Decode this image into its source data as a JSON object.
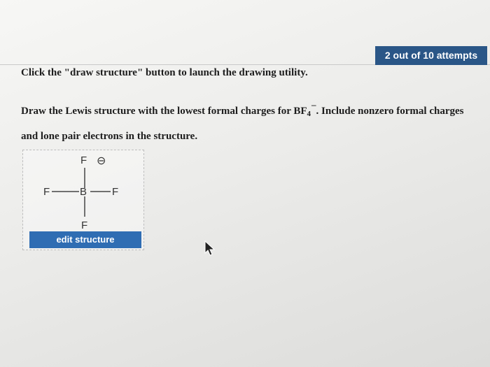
{
  "header": {
    "attempts_label": "2 out of 10 attempts"
  },
  "instruction": {
    "text": "Click the \"draw structure\" button to launch the drawing utility."
  },
  "question": {
    "prefix": "Draw the Lewis structure with the lowest formal charges for BF",
    "subscript": "4",
    "superscript": "–",
    "suffix": ". Include nonzero formal charges and lone pair electrons in the structure."
  },
  "structure": {
    "central_atom": "B",
    "top_atom": "F",
    "left_atom": "F",
    "right_atom": "F",
    "bottom_atom": "F",
    "formal_charge_symbol": "⊖",
    "edit_button_label": "edit structure"
  },
  "colors": {
    "badge_bg": "#2a5687",
    "button_bg": "#2f6db3"
  }
}
